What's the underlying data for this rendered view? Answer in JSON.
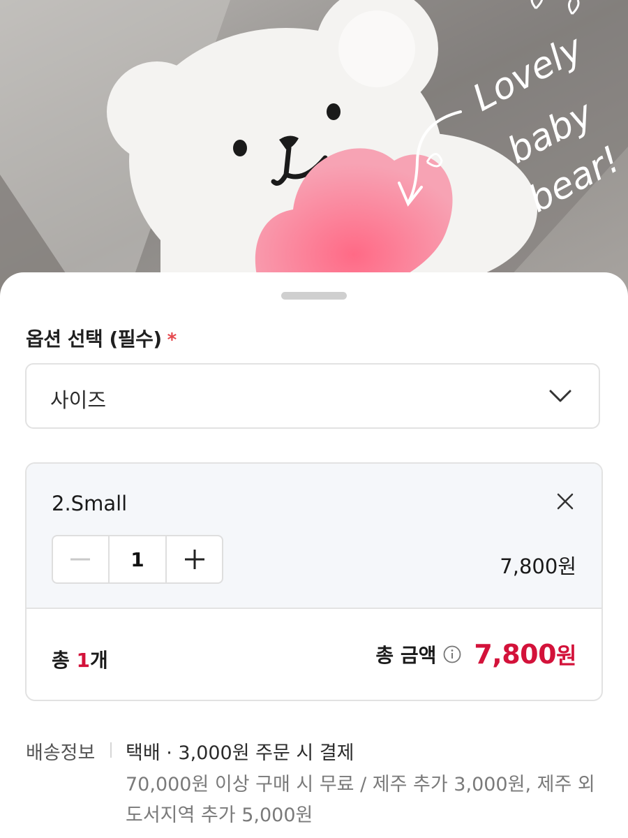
{
  "product_image": {
    "alt": "white bear acrylic holding pink heart",
    "handwriting": [
      "Lovely",
      "baby",
      "bear!"
    ]
  },
  "options": {
    "section_title": "옵션 선택 (필수)",
    "required_mark": "*",
    "select_value": "사이즈"
  },
  "selected_option": {
    "name": "2.Small",
    "quantity": "1",
    "price": "7,800원",
    "minus_symbol": "−",
    "plus_symbol": "+"
  },
  "totals": {
    "count_prefix": "총 ",
    "count_value": "1",
    "count_suffix": "개",
    "amount_label": "총 금액",
    "amount_value": "7,800",
    "amount_unit": "원"
  },
  "shipping": {
    "label": "배송정보",
    "main": "택배 · 3,000원 주문 시 결제",
    "detail": "70,000원 이상 구매 시 무료 / 제주 추가 3,000원, 제주 외 도서지역 추가 5,000원"
  },
  "colors": {
    "accent_red": "#d3123a",
    "required_star": "#e5484d"
  }
}
